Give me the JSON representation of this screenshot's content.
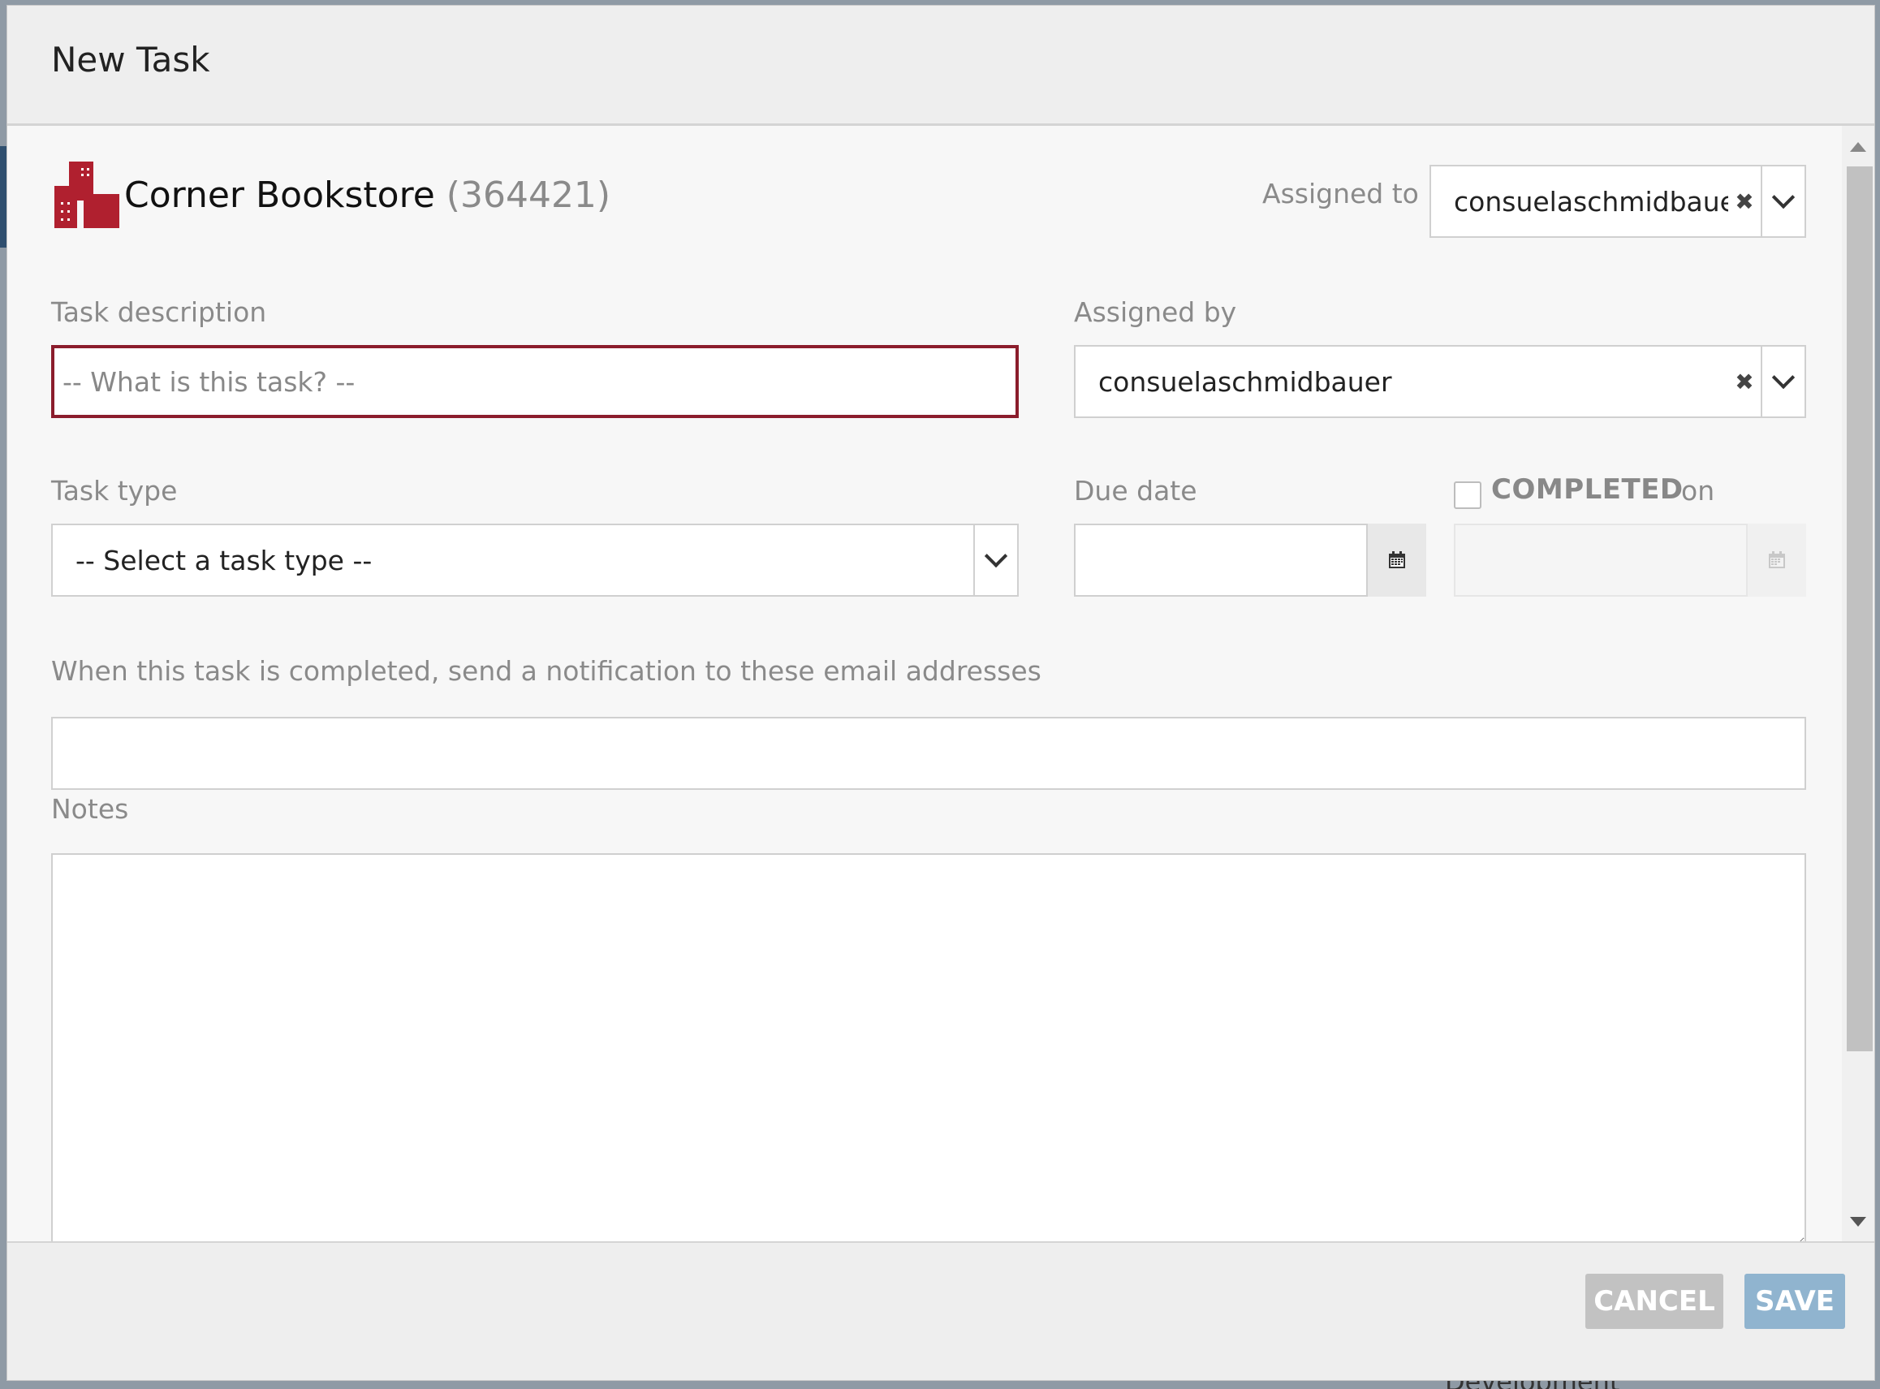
{
  "modal": {
    "title": "New Task"
  },
  "company": {
    "name": "Corner Bookstore",
    "id": "(364421)",
    "logo_color": "#b0202f"
  },
  "assigned_to": {
    "label": "Assigned to",
    "value": "consuelaschmidbauer"
  },
  "task_description": {
    "label": "Task description",
    "placeholder": "-- What is this task? --",
    "value": ""
  },
  "assigned_by": {
    "label": "Assigned by",
    "value": "consuelaschmidbauer"
  },
  "task_type": {
    "label": "Task type",
    "selected": "-- Select a task type --"
  },
  "due_date": {
    "label": "Due date",
    "value": ""
  },
  "completed": {
    "label": "COMPLETED",
    "on_label": "on",
    "checked": false,
    "value": ""
  },
  "notification": {
    "label": "When this task is completed, send a notification to these email addresses",
    "value": ""
  },
  "notes": {
    "label": "Notes",
    "value": ""
  },
  "footer": {
    "cancel_label": "CANCEL",
    "save_label": "SAVE"
  },
  "colors": {
    "invalid_border": "#8b1d2c",
    "save_button": "#90b4cf",
    "cancel_button": "#c2c2c2"
  }
}
